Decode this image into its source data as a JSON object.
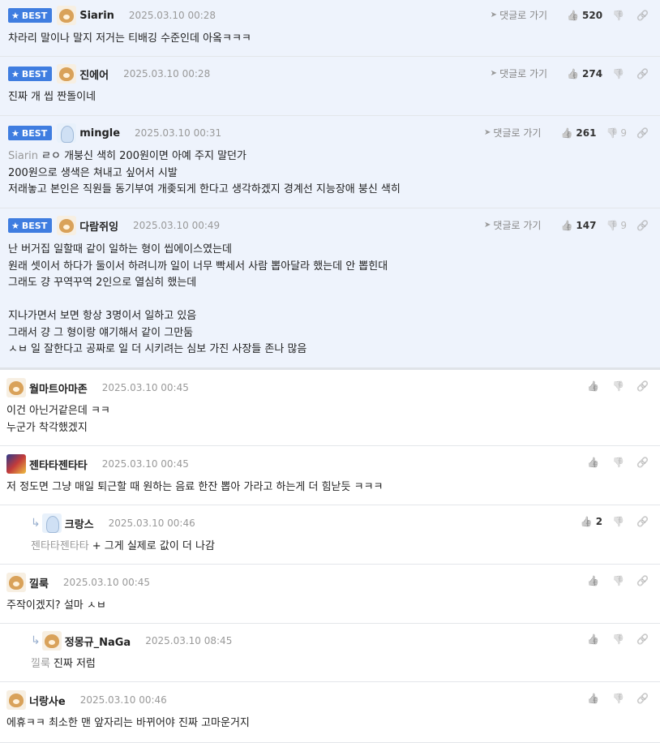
{
  "labels": {
    "best": "BEST",
    "reply_link": "댓글로 가기"
  },
  "icons": {
    "star": "star-icon",
    "reply": "reply-arrow-icon",
    "like": "thumbs-up-icon",
    "dislike": "thumbs-down-icon",
    "link": "link-icon",
    "reply_indent": "reply-indent-icon"
  },
  "comments": [
    {
      "best": true,
      "nick": "Siarin",
      "avatar": "dog",
      "date": "2025.03.10 00:28",
      "like": "520",
      "dislike": "",
      "lines": [
        "차라리 말이나 말지 저거는 티배깅 수준인데 아옼ㅋㅋㅋ"
      ]
    },
    {
      "best": true,
      "nick": "진에어",
      "avatar": "dog",
      "date": "2025.03.10 00:28",
      "like": "274",
      "dislike": "",
      "lines": [
        "진짜 개 씹 짠돌이네"
      ]
    },
    {
      "best": true,
      "nick": "mingle",
      "avatar": "ghost",
      "date": "2025.03.10 00:31",
      "like": "261",
      "dislike": "9",
      "mention": "Siarin",
      "lines": [
        "ㄹㅇ 개붕신 색히 200원이면 아예 주지 말던가",
        "200원으로 생색은 쳐내고 싶어서 시발",
        "저래놓고 본인은 직원들 동기부여 개좆되게 한다고 생각하겠지 경계선 지능장애 붕신 색히"
      ]
    },
    {
      "best": true,
      "nick": "다람쥐잉",
      "avatar": "dog",
      "date": "2025.03.10 00:49",
      "like": "147",
      "dislike": "9",
      "lines": [
        "난 버거집 일할때 같이 일하는 형이 씹에이스였는데",
        "원래 셋이서 하다가 둘이서 하려니까 일이 너무 빡세서 사람 뽑아달라 했는데 안 뽑힌대",
        "그래도 걍 꾸역꾸역 2인으로 열심히 했는데",
        "",
        "지나가면서 보면 항상 3명이서 일하고 있음",
        "그래서 걍 그 형이랑 얘기해서 같이 그만둠",
        "ㅅㅂ 일 잘한다고 공짜로 일 더 시키려는 심보 가진 사장들 존나 많음"
      ]
    },
    {
      "best": false,
      "nick": "월마트아마존",
      "avatar": "dog",
      "date": "2025.03.10 00:45",
      "like": "",
      "dislike": "",
      "lines": [
        "이건 아닌거같은데 ㅋㅋ",
        "누군가 착각했겠지"
      ]
    },
    {
      "best": false,
      "nick": "젠타타젠타타",
      "avatar": "art",
      "date": "2025.03.10 00:45",
      "like": "",
      "dislike": "",
      "lines": [
        "저 정도면 그냥 매일 퇴근할 때 원하는 음료 한잔 뽑아 가라고 하는게 더 힘낟듯 ㅋㅋㅋ"
      ]
    },
    {
      "best": false,
      "reply": true,
      "nick": "크랑스",
      "avatar": "ghost",
      "date": "2025.03.10 00:46",
      "like": "2",
      "dislike": "",
      "mention": "젠타타젠타타",
      "lines": [
        "+ 그게 실제로 값이 더 나감"
      ]
    },
    {
      "best": false,
      "nick": "낄룩",
      "avatar": "dog",
      "date": "2025.03.10 00:45",
      "like": "",
      "dislike": "",
      "lines": [
        "주작이겠지? 설마 ㅅㅂ"
      ]
    },
    {
      "best": false,
      "reply": true,
      "nick": "정몽규_NaGa",
      "avatar": "dog",
      "date": "2025.03.10 08:45",
      "like": "",
      "dislike": "",
      "mention": "낄룩",
      "lines": [
        "진짜 저럼"
      ]
    },
    {
      "best": false,
      "nick": "너랑사e",
      "avatar": "dog",
      "date": "2025.03.10 00:46",
      "like": "",
      "dislike": "",
      "lines": [
        "에휴ㅋㅋ 최소한 맨 앞자리는 바뀌어야 진짜 고마운거지"
      ]
    }
  ]
}
